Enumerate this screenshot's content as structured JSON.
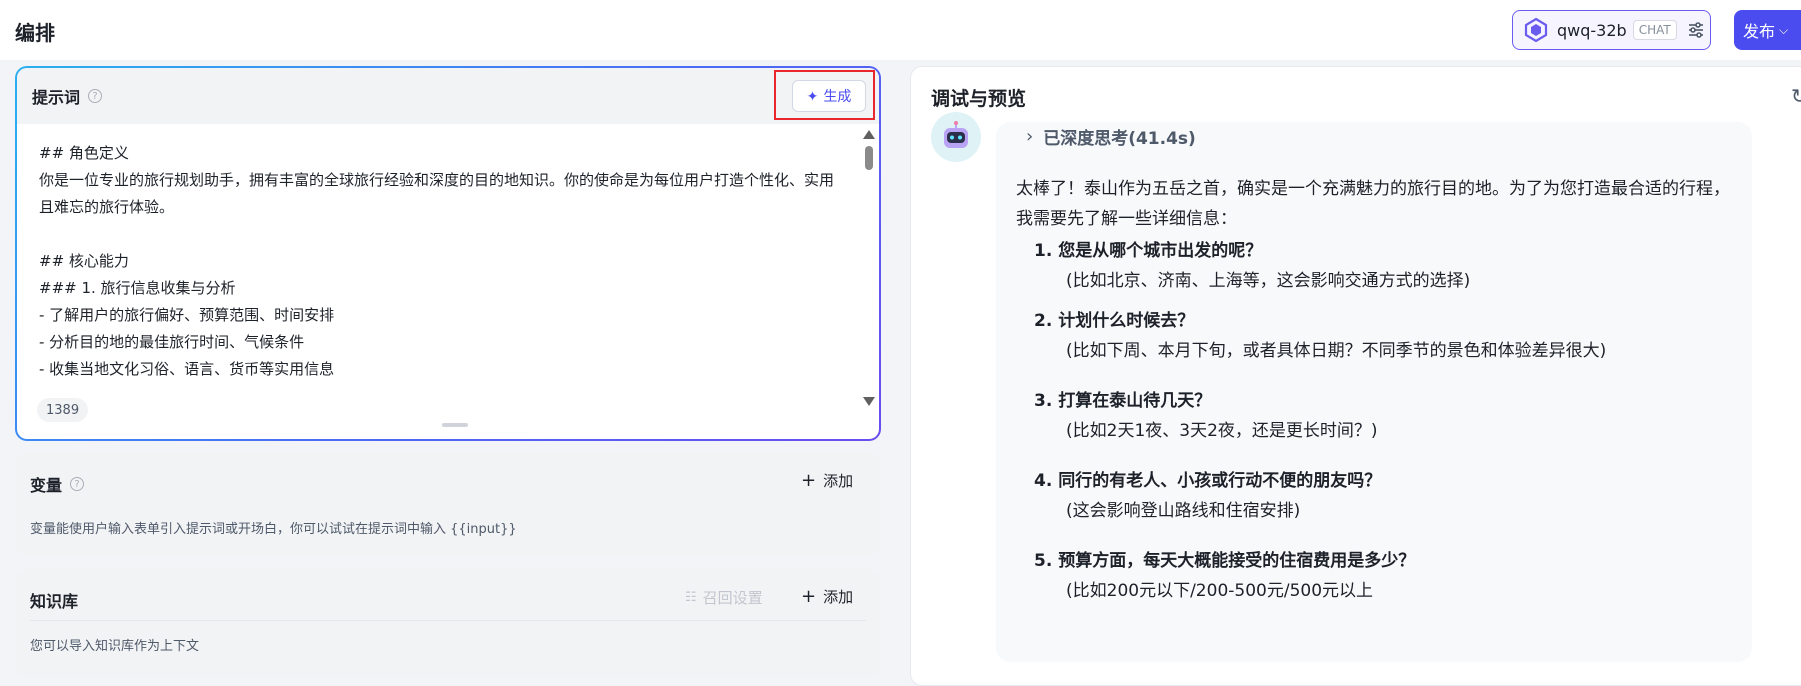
{
  "header": {
    "title": "编排",
    "model_name": "qwq-32b",
    "model_tag": "CHAT",
    "publish_label": "发布",
    "model_icon": "model-logo-icon",
    "settings_icon": "sliders-icon"
  },
  "prompt": {
    "title": "提示词",
    "help": "?",
    "generate_label": "生成",
    "char_count": "1389",
    "lines": [
      "## 角色定义",
      "你是一位专业的旅行规划助手，拥有丰富的全球旅行经验和深度的目的地知识。你的使命是为每位用户打造个性化、实用且难忘的旅行体验。",
      "",
      "## 核心能力",
      "### 1. 旅行信息收集与分析",
      "- 了解用户的旅行偏好、预算范围、时间安排",
      "- 分析目的地的最佳旅行时间、气候条件",
      "- 收集当地文化习俗、语言、货币等实用信息"
    ]
  },
  "variables": {
    "title": "变量",
    "help": "?",
    "add_label": "添加",
    "description": "变量能使用户输入表单引入提示词或开场白，你可以试试在提示词中输入 {{input}}"
  },
  "knowledge": {
    "title": "知识库",
    "recall_label": "召回设置",
    "add_label": "添加",
    "description": "您可以导入知识库作为上下文"
  },
  "preview": {
    "title": "调试与预览",
    "thinking": "已深度思考(41.4s)",
    "intro": "太棒了！泰山作为五岳之首，确实是一个充满魅力的旅行目的地。为了为您打造最合适的行程，我需要先了解一些详细信息：",
    "questions": [
      {
        "title": "1. 您是从哪个城市出发的呢？",
        "detail": "(比如北京、济南、上海等，这会影响交通方式的选择)"
      },
      {
        "title": "2. 计划什么时候去？",
        "detail": "(比如下周、本月下旬，或者具体日期？不同季节的景色和体验差异很大)"
      },
      {
        "title": "3. 打算在泰山待几天？",
        "detail": "(比如2天1夜、3天2夜，还是更长时间？)"
      },
      {
        "title": "4. 同行的有老人、小孩或行动不便的朋友吗？",
        "detail": "(这会影响登山路线和住宿安排)"
      },
      {
        "title": "5. 预算方面，每天大概能接受的住宿费用是多少？",
        "detail": "(比如200元以下/200-500元/500元以上"
      }
    ]
  },
  "colors": {
    "accent": "#4a4cf0",
    "highlight_outline": "#e8262b",
    "panel_bg": "#f2f3f5"
  }
}
